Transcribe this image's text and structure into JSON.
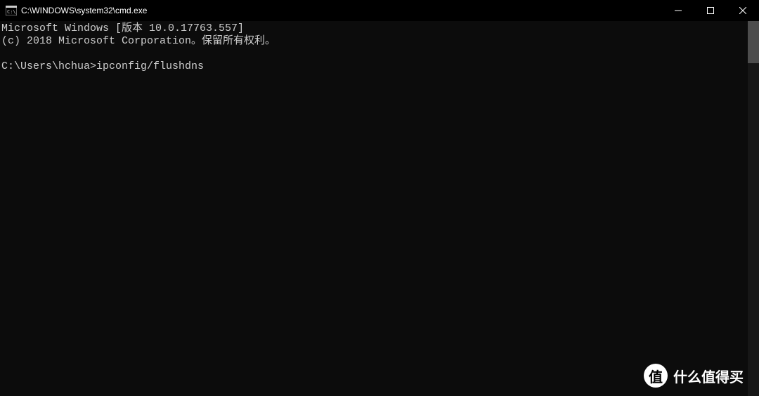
{
  "titlebar": {
    "title": "C:\\WINDOWS\\system32\\cmd.exe"
  },
  "terminal": {
    "line1": "Microsoft Windows [版本 10.0.17763.557]",
    "line2": "(c) 2018 Microsoft Corporation。保留所有权利。",
    "prompt": "C:\\Users\\hchua>",
    "command": "ipconfig/flushdns"
  },
  "watermark": {
    "badge": "值",
    "text": "什么值得买"
  }
}
